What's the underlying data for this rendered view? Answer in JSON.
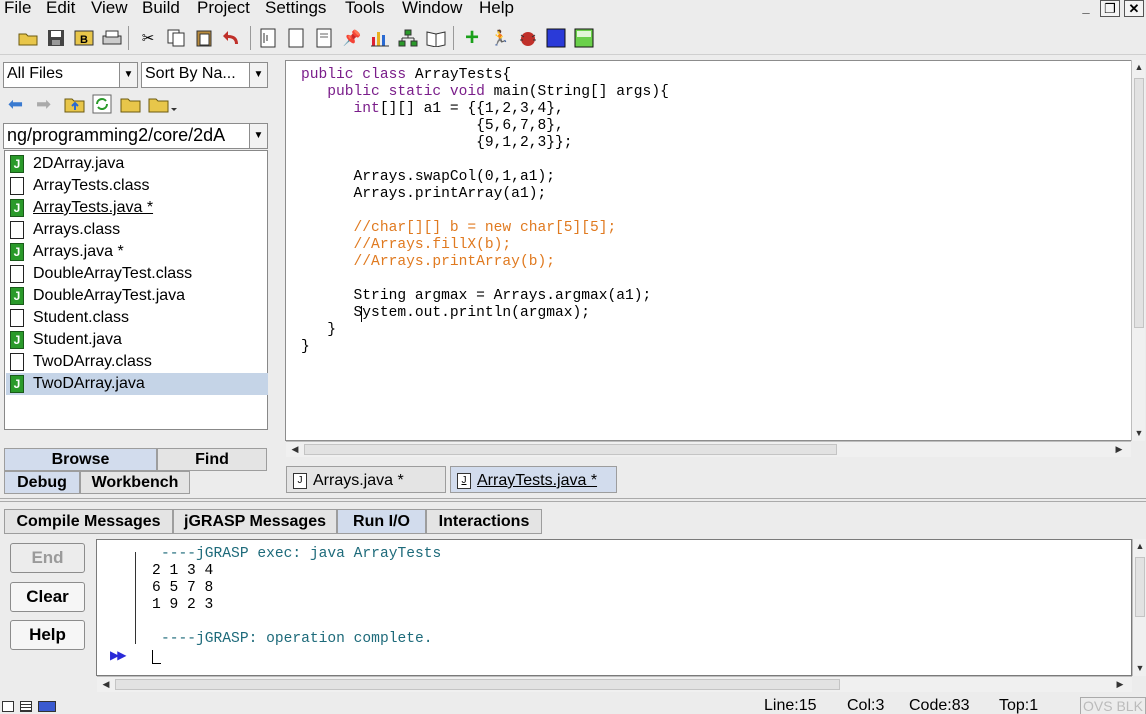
{
  "menu": [
    "File",
    "Edit",
    "View",
    "Build",
    "Project",
    "Settings",
    "Tools",
    "Window",
    "Help"
  ],
  "toolbar_icons": [
    "open-folder-icon",
    "save-icon",
    "backup-icon",
    "print-icon",
    "cut-icon",
    "copy-icon",
    "paste-icon",
    "undo-icon",
    "generate-csd-icon",
    "remove-csd-icon",
    "browse-doc-icon",
    "pin-icon",
    "chart-icon",
    "uml-icon",
    "book-icon",
    "compile-icon",
    "run-icon",
    "debug-icon",
    "stop-icon",
    "panel-icon"
  ],
  "browse": {
    "filter": "All Files",
    "sort": "Sort By Na...",
    "path": "ng/programming2/core/2dA",
    "files": [
      {
        "name": "2DArray.java",
        "type": "java"
      },
      {
        "name": "ArrayTests.class",
        "type": "class"
      },
      {
        "name": "ArrayTests.java *",
        "type": "java"
      },
      {
        "name": "Arrays.class",
        "type": "class"
      },
      {
        "name": "Arrays.java *",
        "type": "java"
      },
      {
        "name": "DoubleArrayTest.class",
        "type": "class"
      },
      {
        "name": "DoubleArrayTest.java",
        "type": "java"
      },
      {
        "name": "Student.class",
        "type": "class"
      },
      {
        "name": "Student.java",
        "type": "java"
      },
      {
        "name": "TwoDArray.class",
        "type": "class"
      },
      {
        "name": "TwoDArray.java",
        "type": "java"
      }
    ],
    "selected": "TwoDArray.java"
  },
  "left_tabs": {
    "browse": "Browse",
    "find": "Find",
    "debug": "Debug",
    "workbench": "Workbench"
  },
  "code": {
    "l1a": "public class",
    "l1b": " ArrayTests{",
    "l2a": "   public static void",
    "l2b": " main(String[] args){",
    "l3a": "      int",
    "l3b": "[][] a1 = {{1,2,3,4},",
    "l4": "                    {5,6,7,8},",
    "l5": "                    {9,1,2,3}};",
    "l7": "      Arrays.swapCol(0,1,a1);",
    "l8": "      Arrays.printArray(a1);",
    "l10": "      //char[][] b = new char[5][5];",
    "l11": "      //Arrays.fillX(b);",
    "l12": "      //Arrays.printArray(b);",
    "l14": "      String argmax = Arrays.argmax(a1);",
    "l15": "      System.out.println(argmax);",
    "l16": "   }",
    "l17": "}"
  },
  "editor_tabs": [
    "Arrays.java *",
    "ArrayTests.java *"
  ],
  "message_tabs": [
    "Compile Messages",
    "jGRASP Messages",
    "Run I/O",
    "Interactions"
  ],
  "active_message_tab": "Run I/O",
  "side_buttons": {
    "end": "End",
    "clear": "Clear",
    "help": "Help"
  },
  "output": {
    "exec": "----jGRASP exec: java ArrayTests",
    "row1": "2 1 3 4",
    "row2": "6 5 7 8",
    "row3": "1 9 2 3",
    "complete": "----jGRASP: operation complete.",
    "prompt": "▶▶"
  },
  "status": {
    "line": "Line:15",
    "col": "Col:3",
    "code": "Code:83",
    "top": "Top:1",
    "mode": "OVS BLK"
  },
  "colors": {
    "keyword": "#7a1d8a",
    "comment": "#e07a20",
    "jgrasp_msg": "#1d6a7a",
    "selection": "#c5d4e7",
    "java_icon": "#2a9a2a"
  }
}
